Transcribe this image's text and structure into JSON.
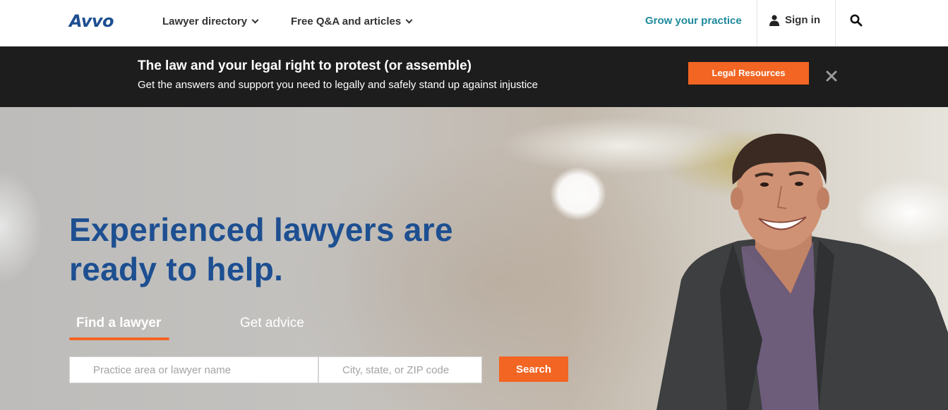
{
  "header": {
    "logo": "Avvo",
    "nav": [
      {
        "label": "Lawyer directory"
      },
      {
        "label": "Free Q&A and articles"
      }
    ],
    "grow_label": "Grow your practice",
    "signin_label": "Sign in",
    "icons": {
      "user": "user-icon",
      "search": "search-icon"
    }
  },
  "banner": {
    "title": "The law and your legal right to protest (or assemble)",
    "subtitle": "Get the answers and support you need to legally and safely stand up against injustice",
    "button_label": "Legal Resources",
    "close_icon": "close-icon"
  },
  "hero": {
    "heading": "Experienced lawyers are ready to help.",
    "tabs": [
      {
        "label": "Find a lawyer",
        "active": true
      },
      {
        "label": "Get advice",
        "active": false
      }
    ],
    "practice_placeholder": "Practice area or lawyer name",
    "location_placeholder": "City, state, or ZIP code",
    "search_label": "Search"
  },
  "colors": {
    "brand_blue": "#1d4f91",
    "accent_orange": "#f26522",
    "teal": "#1f8a9c",
    "banner_bg": "#1d1d1d"
  }
}
